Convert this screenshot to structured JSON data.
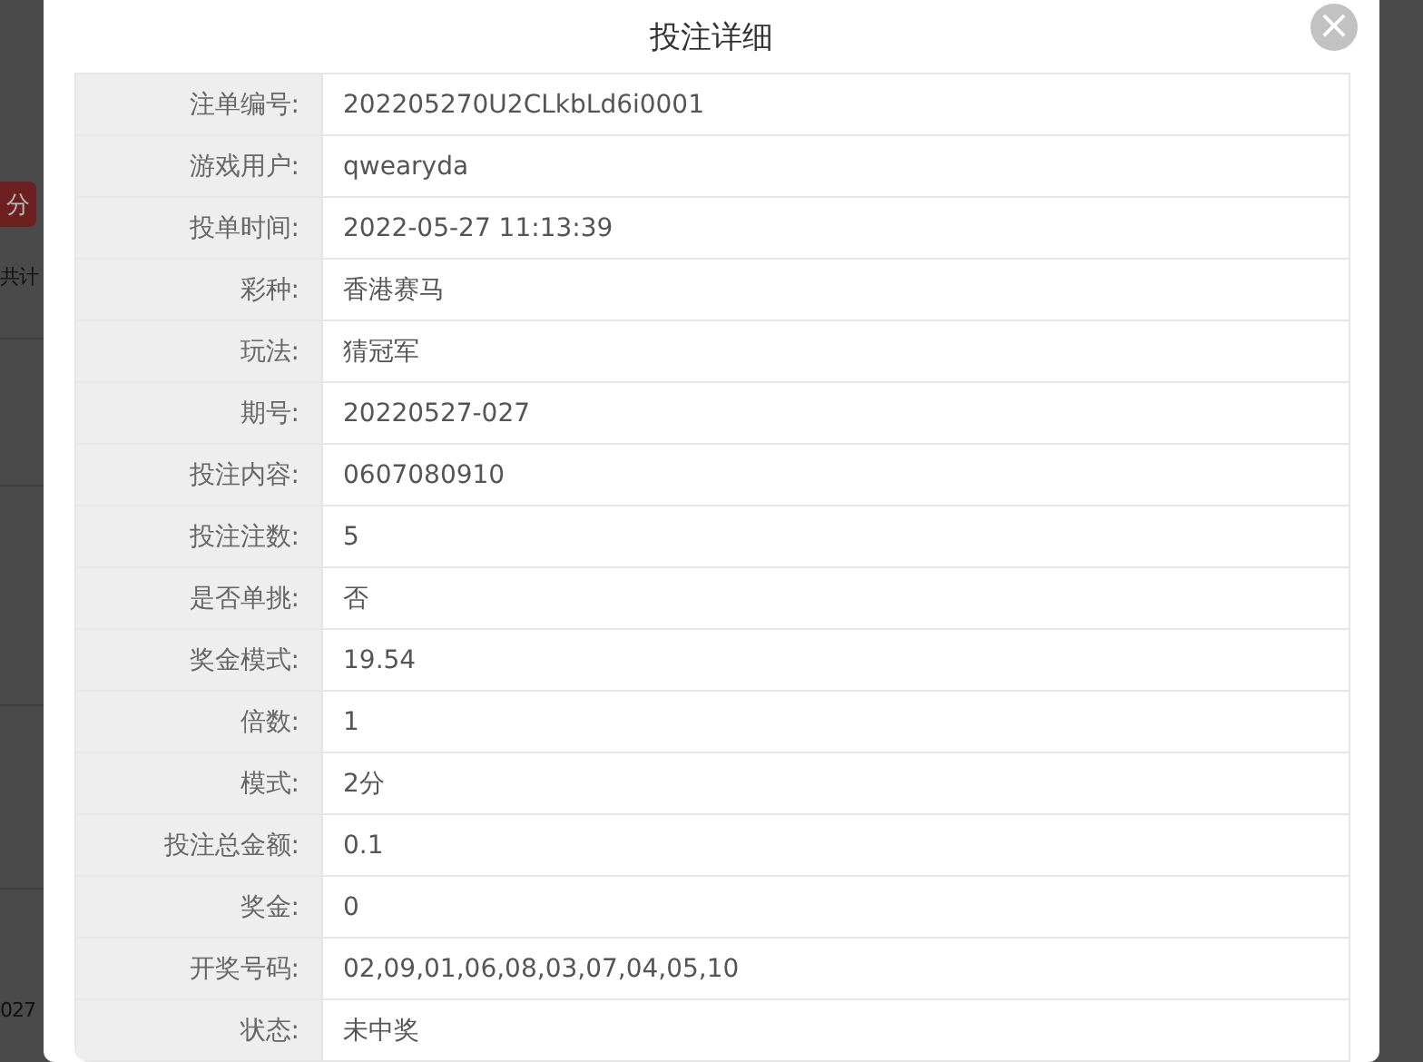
{
  "background": {
    "badge": "分",
    "total_label": "共计",
    "row_text": "027"
  },
  "dialog": {
    "title": "投注详细",
    "close": "×",
    "fields": [
      {
        "label": "注单编号:",
        "value": "202205270U2CLkbLd6i0001"
      },
      {
        "label": "游戏用户:",
        "value": "qwearyda"
      },
      {
        "label": "投单时间:",
        "value": "2022-05-27 11:13:39"
      },
      {
        "label": "彩种:",
        "value": "香港赛马"
      },
      {
        "label": "玩法:",
        "value": "猜冠军"
      },
      {
        "label": "期号:",
        "value": "20220527-027"
      },
      {
        "label": "投注内容:",
        "value": "0607080910"
      },
      {
        "label": "投注注数:",
        "value": "5"
      },
      {
        "label": "是否单挑:",
        "value": "否"
      },
      {
        "label": "奖金模式:",
        "value": "19.54"
      },
      {
        "label": "倍数:",
        "value": "1"
      },
      {
        "label": "模式:",
        "value": "2分"
      },
      {
        "label": "投注总金额:",
        "value": "0.1"
      },
      {
        "label": "奖金:",
        "value": "0"
      },
      {
        "label": "开奖号码:",
        "value": "02,09,01,06,08,03,07,04,05,10"
      },
      {
        "label": "状态:",
        "value": "未中奖"
      }
    ]
  }
}
